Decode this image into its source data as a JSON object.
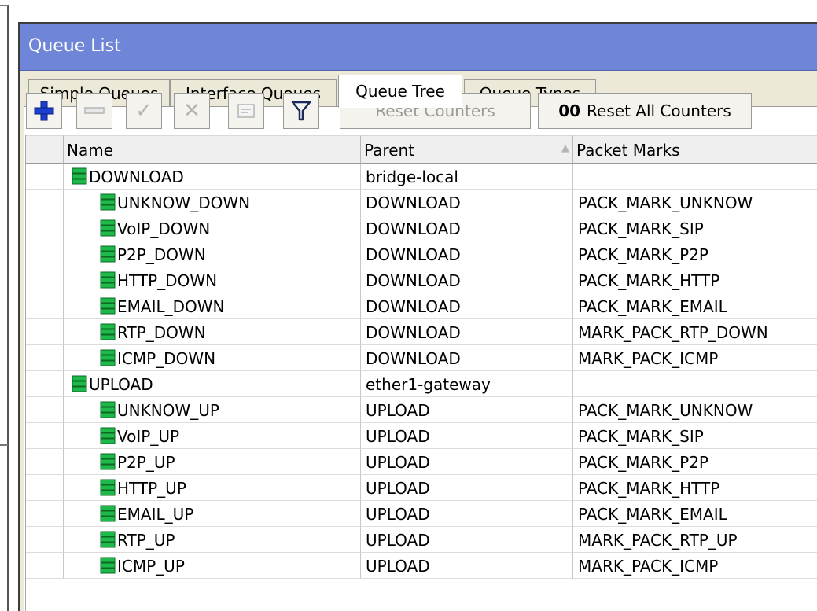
{
  "window": {
    "title": "Queue List"
  },
  "tabs": [
    {
      "label": "Simple Queues",
      "active": false
    },
    {
      "label": "Interface Queues",
      "active": false
    },
    {
      "label": "Queue Tree",
      "active": true
    },
    {
      "label": "Queue Types",
      "active": false
    }
  ],
  "toolbar": {
    "add_icon": "plus-icon",
    "remove_icon": "minus-icon",
    "enable_icon": "check-icon",
    "disable_icon": "cross-icon",
    "comment_icon": "comment-icon",
    "filter_icon": "filter-icon",
    "reset_counters_label": "Reset Counters",
    "reset_all_prefix": "00",
    "reset_all_label": "Reset All Counters"
  },
  "table": {
    "columns": [
      "Name",
      "Parent",
      "Packet Marks"
    ],
    "sort_column": "Parent",
    "rows": [
      {
        "name": "DOWNLOAD",
        "parent": "bridge-local",
        "packet_marks": "",
        "level": 0
      },
      {
        "name": "UNKNOW_DOWN",
        "parent": "DOWNLOAD",
        "packet_marks": "PACK_MARK_UNKNOW",
        "level": 1
      },
      {
        "name": "VoIP_DOWN",
        "parent": "DOWNLOAD",
        "packet_marks": "PACK_MARK_SIP",
        "level": 1
      },
      {
        "name": "P2P_DOWN",
        "parent": "DOWNLOAD",
        "packet_marks": "PACK_MARK_P2P",
        "level": 1
      },
      {
        "name": "HTTP_DOWN",
        "parent": "DOWNLOAD",
        "packet_marks": "PACK_MARK_HTTP",
        "level": 1
      },
      {
        "name": "EMAIL_DOWN",
        "parent": "DOWNLOAD",
        "packet_marks": "PACK_MARK_EMAIL",
        "level": 1
      },
      {
        "name": "RTP_DOWN",
        "parent": "DOWNLOAD",
        "packet_marks": "MARK_PACK_RTP_DOWN",
        "level": 1
      },
      {
        "name": "ICMP_DOWN",
        "parent": "DOWNLOAD",
        "packet_marks": "MARK_PACK_ICMP",
        "level": 1
      },
      {
        "name": "UPLOAD",
        "parent": "ether1-gateway",
        "packet_marks": "",
        "level": 0
      },
      {
        "name": "UNKNOW_UP",
        "parent": "UPLOAD",
        "packet_marks": "PACK_MARK_UNKNOW",
        "level": 1
      },
      {
        "name": "VoIP_UP",
        "parent": "UPLOAD",
        "packet_marks": "PACK_MARK_SIP",
        "level": 1
      },
      {
        "name": "P2P_UP",
        "parent": "UPLOAD",
        "packet_marks": "PACK_MARK_P2P",
        "level": 1
      },
      {
        "name": "HTTP_UP",
        "parent": "UPLOAD",
        "packet_marks": "PACK_MARK_HTTP",
        "level": 1
      },
      {
        "name": "EMAIL_UP",
        "parent": "UPLOAD",
        "packet_marks": "PACK_MARK_EMAIL",
        "level": 1
      },
      {
        "name": "RTP_UP",
        "parent": "UPLOAD",
        "packet_marks": "MARK_PACK_RTP_UP",
        "level": 1
      },
      {
        "name": "ICMP_UP",
        "parent": "UPLOAD",
        "packet_marks": "MARK_PACK_ICMP",
        "level": 1
      }
    ]
  },
  "colors": {
    "titlebar": "#6f86d8",
    "queue_icon": "#1fb84a",
    "add_icon": "#1a3fd0"
  }
}
